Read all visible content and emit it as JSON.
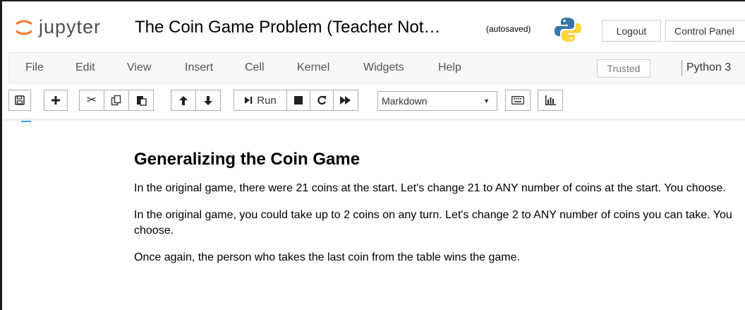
{
  "header": {
    "logo_text": "jupyter",
    "notebook_title": "The Coin Game Problem (Teacher Not…",
    "autosave_status": "(autosaved)",
    "logout_label": "Logout",
    "control_panel_label": "Control Panel"
  },
  "menu": {
    "items": [
      "File",
      "Edit",
      "View",
      "Insert",
      "Cell",
      "Kernel",
      "Widgets",
      "Help"
    ],
    "trusted_label": "Trusted",
    "kernel_name": "Python 3"
  },
  "toolbar": {
    "run_label": "Run",
    "cell_type": "Markdown"
  },
  "content": {
    "heading": "Generalizing the Coin Game",
    "paragraphs": [
      "In the original game, there were 21 coins at the start. Let's change 21 to ANY number of coins at the start. You choose.",
      "In the original game, you could take up to 2 coins on any turn. Let's change 2 to ANY number of coins you can take. You choose.",
      "Once again, the person who takes the last coin from the table wins the game."
    ]
  },
  "colors": {
    "jupyter_orange": "#f37726",
    "python_blue": "#3776ab",
    "python_yellow": "#ffd43b",
    "menubar_bg": "#f8f8f8"
  },
  "icons": [
    "save-icon",
    "plus-icon",
    "cut-icon",
    "copy-icon",
    "paste-icon",
    "arrow-up-icon",
    "arrow-down-icon",
    "step-icon",
    "stop-icon",
    "restart-icon",
    "fast-forward-icon",
    "keyboard-icon",
    "bar-chart-icon"
  ]
}
